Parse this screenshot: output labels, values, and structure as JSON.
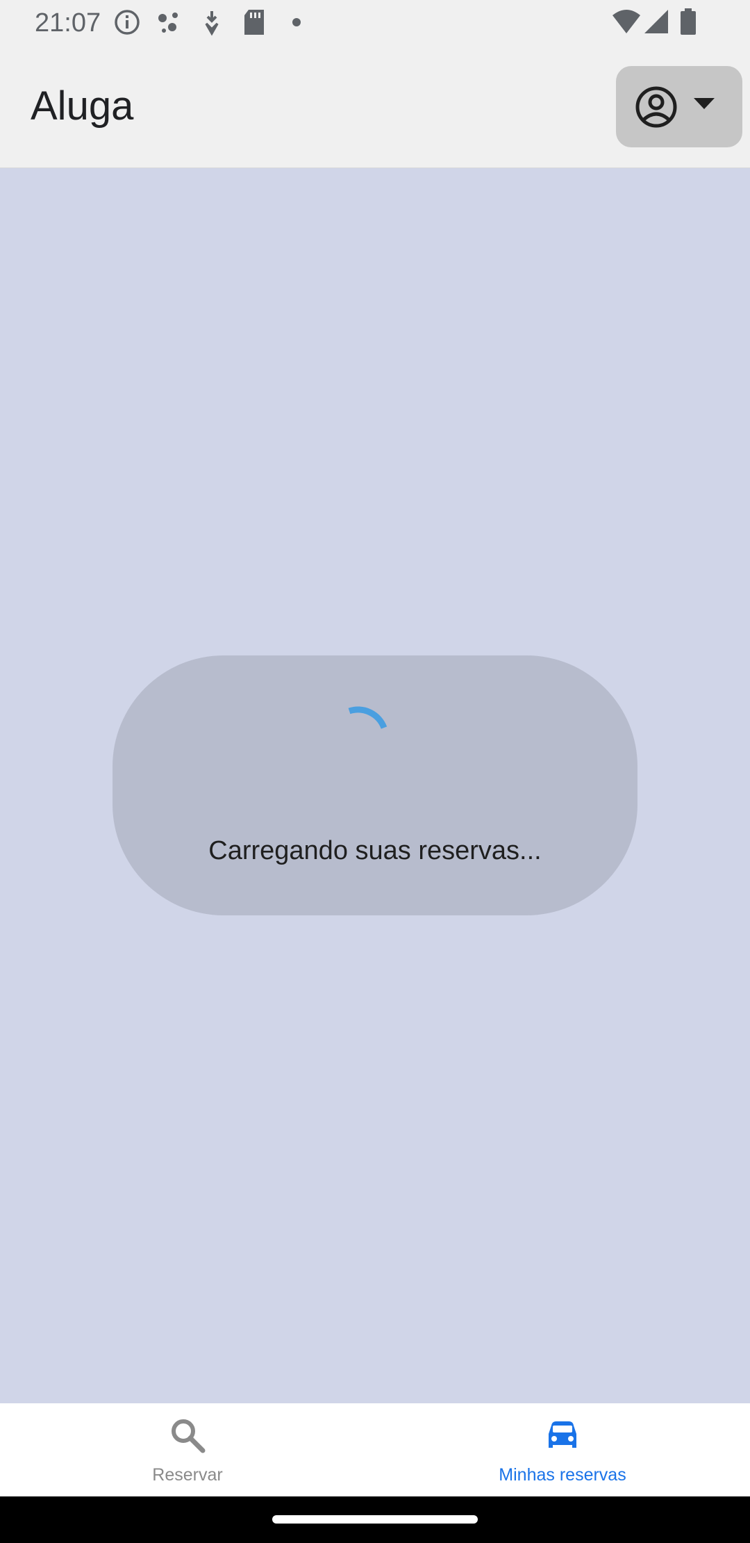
{
  "status_bar": {
    "time": "21:07",
    "icons": [
      "info-icon",
      "assistant-dots-icon",
      "download-icon",
      "sd-card-icon",
      "dot-icon",
      "wifi-icon",
      "signal-icon",
      "battery-icon"
    ]
  },
  "app_bar": {
    "title": "Aluga",
    "account_icon": "account-circle-icon",
    "menu_icon": "caret-down-icon"
  },
  "main": {
    "loading_text": "Carregando suas reservas...",
    "spinner_color": "#4a9fe0"
  },
  "bottom_nav": {
    "items": [
      {
        "label": "Reservar",
        "icon": "search-icon",
        "active": false
      },
      {
        "label": "Minhas reservas",
        "icon": "car-icon",
        "active": true
      }
    ],
    "active_color": "#1a73e8",
    "inactive_color": "#8a8a8a"
  }
}
